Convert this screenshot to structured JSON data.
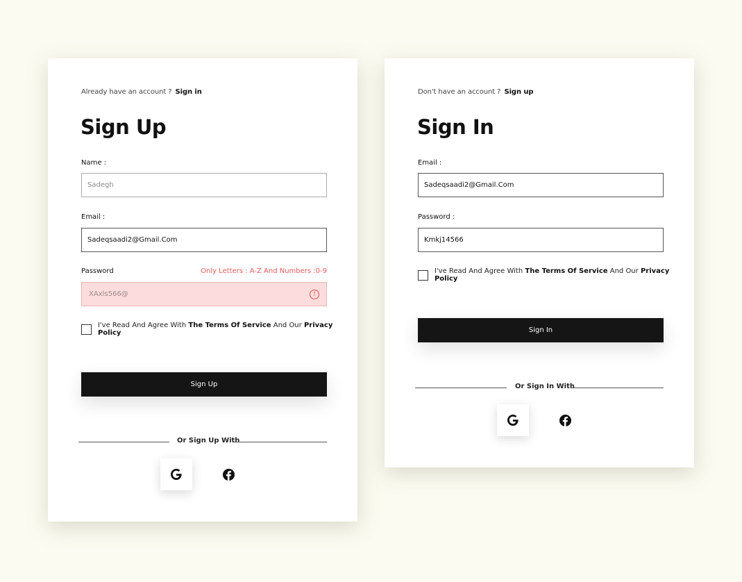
{
  "signup": {
    "prompt": "Already have an account ?",
    "prompt_link": "Sign in",
    "title": "Sign Up",
    "name_label": "Name :",
    "name_value": "Sadegh",
    "email_label": "Email :",
    "email_value": "Sadeqsaadi2@Gmail.Com",
    "password_label": "Password",
    "password_hint": "Only Letters : A-Z And Numbers :0-9",
    "password_value": "XAxls566@",
    "agree_prefix": "I've Read And Agree With",
    "agree_terms": "The Terms Of Service",
    "agree_mid": "And Our",
    "agree_privacy": "Privacy Policy",
    "button_label": "Sign Up",
    "divider_text": "Or Sign Up With",
    "error_icon": "!"
  },
  "signin": {
    "prompt": "Don't have an account ?",
    "prompt_link": "Sign up",
    "title": "Sign In",
    "email_label": "Email :",
    "email_value": "Sadeqsaadi2@Gmail.Com",
    "password_label": "Password :",
    "password_value": "Kmkj14566",
    "agree_prefix": "I've Read And Agree With",
    "agree_terms": "The Terms Of Service",
    "agree_mid": "And Our",
    "agree_privacy": "Privacy Policy",
    "button_label": "Sign In",
    "divider_text": "Or Sign In With"
  },
  "icons": {
    "google": "google-icon",
    "facebook": "facebook-icon",
    "error": "alert-circle-icon"
  },
  "colors": {
    "background": "#fbfbf1",
    "button": "#151515",
    "error_fill": "#fcdcdc",
    "error_text": "#e35b5b"
  }
}
